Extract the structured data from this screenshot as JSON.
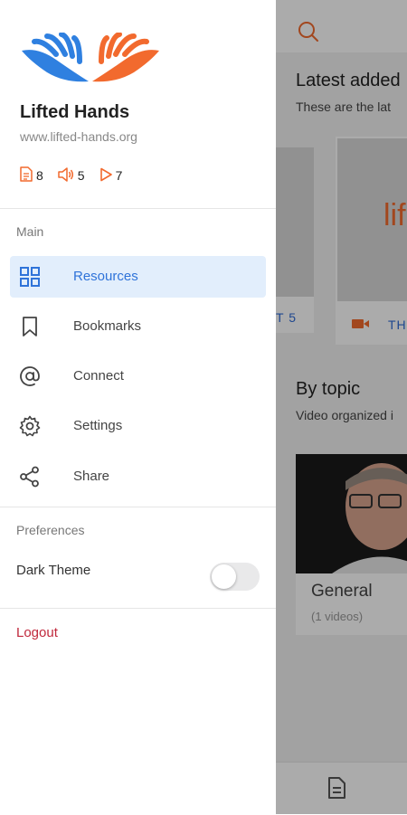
{
  "app": {
    "name": "Lifted Hands",
    "url": "www.lifted-hands.org",
    "stats": {
      "documents": "8",
      "audio": "5",
      "videos": "7"
    }
  },
  "drawer": {
    "main_label": "Main",
    "menu": [
      {
        "label": "Resources",
        "icon": "grid-icon",
        "active": true
      },
      {
        "label": "Bookmarks",
        "icon": "bookmark-icon",
        "active": false
      },
      {
        "label": "Connect",
        "icon": "at-icon",
        "active": false
      },
      {
        "label": "Settings",
        "icon": "gear-icon",
        "active": false
      },
      {
        "label": "Share",
        "icon": "share-icon",
        "active": false
      }
    ],
    "preferences_label": "Preferences",
    "dark_theme_label": "Dark Theme",
    "dark_theme_enabled": false,
    "logout_label": "Logout"
  },
  "background": {
    "latest_title": "Latest added",
    "latest_subtitle": "These are the lat",
    "card_left_text": "T 5",
    "card_right_text": "TH",
    "card_logo_text": "lif",
    "topic_title": "By topic",
    "topic_subtitle": "Video organized i",
    "topic_name": "General",
    "topic_count": "(1 videos)"
  },
  "colors": {
    "accent_blue": "#2f73d9",
    "accent_orange": "#f26a2e",
    "logout_red": "#c0283c",
    "active_bg": "#e2eefc"
  }
}
